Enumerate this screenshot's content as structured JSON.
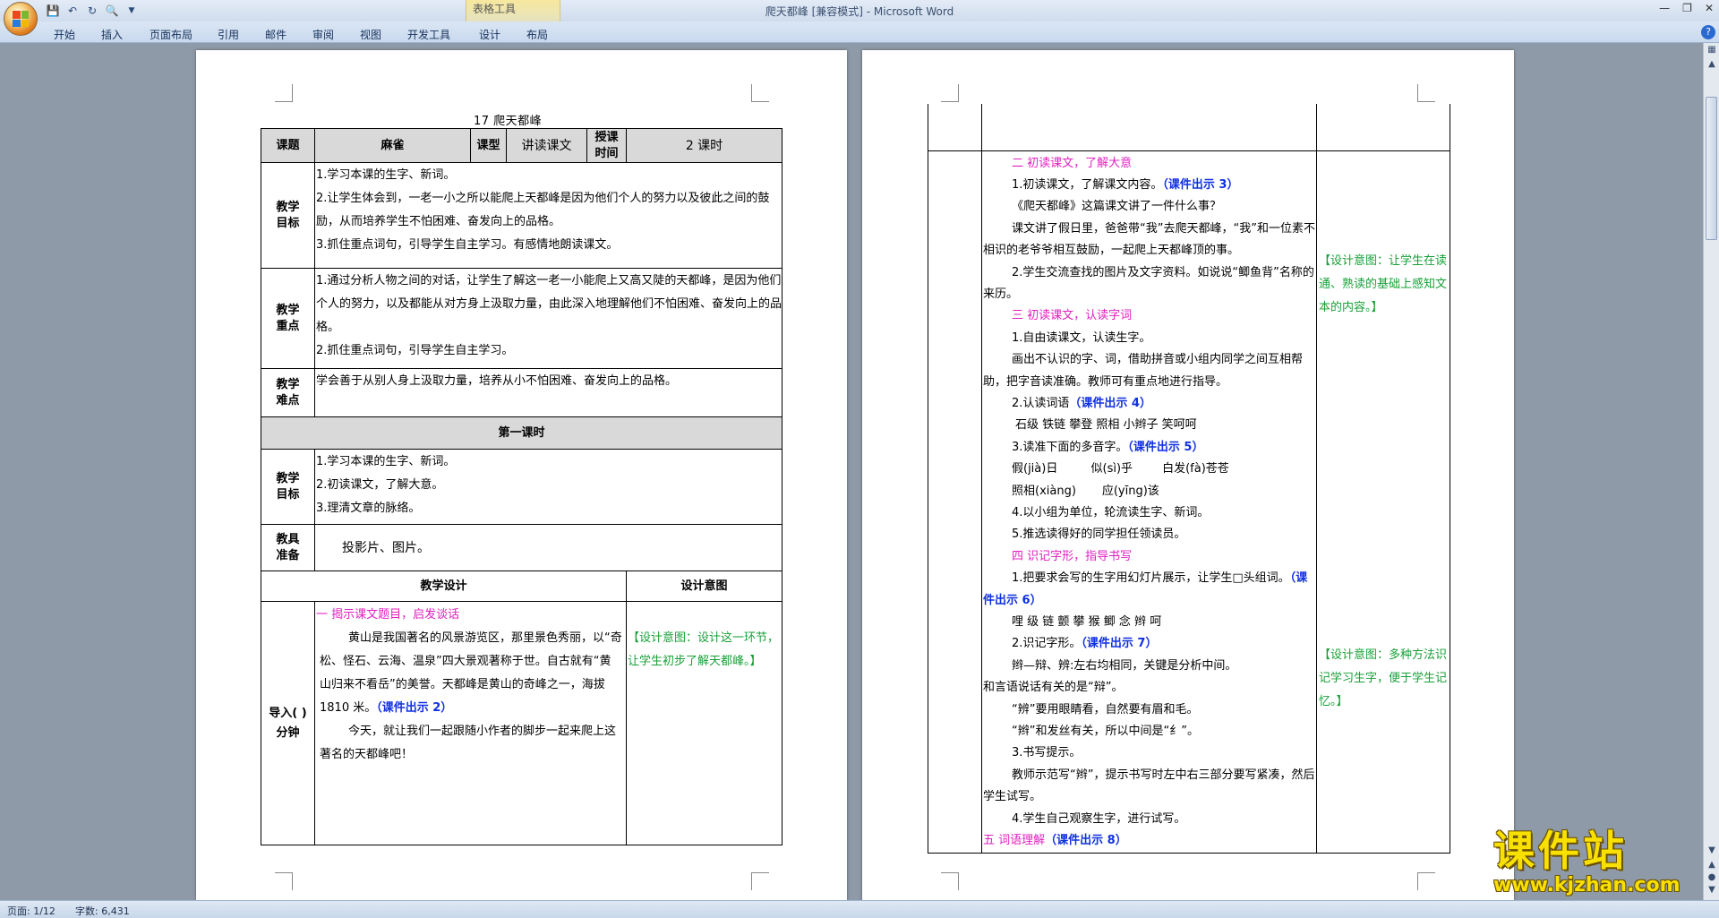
{
  "window": {
    "title": "爬天都峰 [兼容模式] - Microsoft Word",
    "context_group": "表格工具"
  },
  "ribbon": {
    "tabs": [
      "开始",
      "插入",
      "页面布局",
      "引用",
      "邮件",
      "审阅",
      "视图",
      "开发工具",
      "设计",
      "布局"
    ]
  },
  "status": {
    "page": "页面: 1/12",
    "words": "字数: 6,431"
  },
  "page1": {
    "title": "17   爬天都峰",
    "header": {
      "c1": "课题",
      "c2": "麻雀",
      "c3": "课型",
      "c4": "讲读课文",
      "c5": "授课时间",
      "c6": "2 课时"
    },
    "goals": {
      "label": "教学目标",
      "l1": "1.学习本课的生字、新词。",
      "l2": "2.让学生体会到，一老一小之所以能爬上天都峰是因为他们个人的努力以及彼此之间的鼓励，从而培养学生不怕困难、奋发向上的品格。",
      "l3": "3.抓住重点词句，引导学生自主学习。有感情地朗读课文。"
    },
    "key": {
      "label": "教学重点",
      "l1": "1.通过分析人物之间的对话，让学生了解这一老一小能爬上又高又陡的天都峰，是因为他们个人的努力，以及都能从对方身上汲取力量，由此深入地理解他们不怕困难、奋发向上的品格。",
      "l2": "2.抓住重点词句，引导学生自主学习。"
    },
    "diff": {
      "label": "教学难点",
      "l1": "学会善于从别人身上汲取力量，培养从小不怕困难、奋发向上的品格。"
    },
    "first_period": "第一课时",
    "goals2": {
      "label": "教学目标",
      "l1": "1.学习本课的生字、新词。",
      "l2": "2.初读课文，了解大意。",
      "l3": "3.理清文章的脉络。"
    },
    "tools": {
      "label": "教具准备",
      "l1": "投影片、图片。"
    },
    "design_header": "教学设计",
    "intent_header": "设计意图",
    "intro": {
      "label": "导入(    )分钟",
      "h": "一  揭示课文题目，启发谈话",
      "p1": "黄山是我国著名的风景游览区，那里景色秀丽，以“奇松、怪石、云海、温泉”四大景观著称于世。自古就有“黄山归来不看岳”的美誉。天都峰是黄山的奇峰之一，海拔 1810 米。",
      "p1_link": "（课件出示 2）",
      "p2": "今天，就让我们一起跟随小作者的脚步一起来爬上这著名的天都峰吧！",
      "intent": "【设计意图：设计这一环节，让学生初步了解天都峰。】"
    }
  },
  "page2": {
    "s2_h": "二   初读课文，了解大意",
    "s2_1": "1.初读课文，了解课文内容。",
    "s2_1_link": "（课件出示 3）",
    "s2_q": "《爬天都峰》这篇课文讲了一件什么事？",
    "s2_a": "课文讲了假日里，爸爸带“我”去爬天都峰，“我”和一位素不相识的老爷爷相互鼓励，一起爬上天都峰顶的事。",
    "s2_2": "2.学生交流查找的图片及文字资料。如说说“鲫鱼背”名称的来历。",
    "s2_intent": "【设计意图：让学生在读通、熟读的基础上感知文本的内容。】",
    "s3_h": "三   初读课文，认读字词",
    "s3_1": "1.自由读课文，认读生字。",
    "s3_1b": "画出不认识的字、词，借助拼音或小组内同学之间互相帮助，把字音读准确。教师可有重点地进行指导。",
    "s3_2": "2.认读词语",
    "s3_2_link": "（课件出示 4）",
    "s3_words": "石级   铁链   攀登   照相   小辫子   笑呵呵",
    "s3_3": "3.读准下面的多音字。",
    "s3_3_link": "（课件出示 5）",
    "s3_poly1": "假(jià)日         似(sì)乎        白发(fà)苍苍",
    "s3_poly2": "照相(xiàng)       应(yīng)该",
    "s3_4": "4.以小组为单位，轮流读生字、新词。",
    "s3_5": "5.推选读得好的同学担任领读员。",
    "s4_h": "四   识记字形，指导书写",
    "s4_1": "1.把要求会写的生字用幻灯片展示，让学生□头组词。",
    "s4_1_link": "（课件出示 6）",
    "s4_chars": "哩   级   链   颤   攀   猴   鲫   念   辫   呵",
    "s4_2": "2.识记字形。",
    "s4_2_link": "（课件出示 7）",
    "s4_2a": "辫—辩、辨:左右均相同，关键是分析中间。",
    "s4_2b": "和言语说话有关的是“辩”。",
    "s4_2c": "“辨”要用眼睛看，自然要有眉和毛。",
    "s4_2d": "“辫”和发丝有关，所以中间是“纟”。",
    "s4_3": "3.书写提示。",
    "s4_3a": "教师示范写“辫”，提示书写时左中右三部分要写紧凑，然后学生试写。",
    "s4_4": "4.学生自己观察生字，进行试写。",
    "s4_intent": "【设计意图：多种方法识记学习生字，便于学生记忆。】",
    "s5_h": "五   词语理解",
    "s5_link": "（课件出示 8）"
  },
  "watermark": {
    "text": "课件站",
    "url": "www.kjzhan.com"
  }
}
